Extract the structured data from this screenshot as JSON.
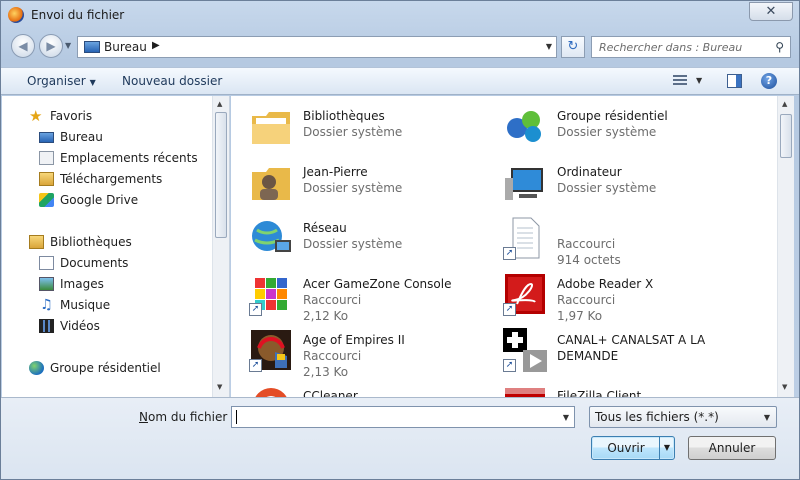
{
  "window": {
    "title": "Envoi du fichier",
    "close_glyph": "✕"
  },
  "address": {
    "location": "Bureau",
    "search_placeholder": "Rechercher dans : Bureau"
  },
  "toolbar": {
    "organize_label": "Organiser",
    "new_folder_label": "Nouveau dossier",
    "help_glyph": "?"
  },
  "sidebar": {
    "favorites": {
      "label": "Favoris"
    },
    "favorite_items": [
      {
        "label": "Bureau",
        "icon": "desktop-icon"
      },
      {
        "label": "Emplacements récents",
        "icon": "recent-places-icon"
      },
      {
        "label": "Téléchargements",
        "icon": "downloads-icon"
      },
      {
        "label": "Google Drive",
        "icon": "google-drive-icon"
      }
    ],
    "libraries": {
      "label": "Bibliothèques"
    },
    "library_items": [
      {
        "label": "Documents",
        "icon": "documents-icon"
      },
      {
        "label": "Images",
        "icon": "pictures-icon"
      },
      {
        "label": "Musique",
        "icon": "music-icon"
      },
      {
        "label": "Vidéos",
        "icon": "videos-icon"
      }
    ],
    "homegroup": {
      "label": "Groupe résidentiel"
    }
  },
  "files": [
    {
      "name": "Bibliothèques",
      "sub1": "Dossier système",
      "sub2": "",
      "icon": "libraries-folder-icon"
    },
    {
      "name": "Groupe résidentiel",
      "sub1": "Dossier système",
      "sub2": "",
      "icon": "homegroup-icon"
    },
    {
      "name": "Jean-Pierre",
      "sub1": "Dossier système",
      "sub2": "",
      "icon": "user-folder-icon"
    },
    {
      "name": "Ordinateur",
      "sub1": "Dossier système",
      "sub2": "",
      "icon": "computer-icon"
    },
    {
      "name": "Réseau",
      "sub1": "Dossier système",
      "sub2": "",
      "icon": "network-icon"
    },
    {
      "name": "",
      "sub1": "Raccourci",
      "sub2": "914 octets",
      "icon": "blank-shortcut-icon"
    },
    {
      "name": "Acer GameZone Console",
      "sub1": "Raccourci",
      "sub2": "2,12 Ko",
      "icon": "gamezone-icon"
    },
    {
      "name": "Adobe Reader X",
      "sub1": "Raccourci",
      "sub2": "1,97 Ko",
      "icon": "adobe-reader-icon"
    },
    {
      "name": "Age of Empires II",
      "sub1": "Raccourci",
      "sub2": "2,13 Ko",
      "icon": "age-of-empires-icon"
    },
    {
      "name": "CANAL+ CANALSAT A LA",
      "sub1": "DEMANDE",
      "sub2": "",
      "icon": "canal-plus-icon"
    },
    {
      "name": "CCleaner",
      "sub1": "",
      "sub2": "",
      "icon": "ccleaner-icon"
    },
    {
      "name": "FileZilla Client",
      "sub1": "",
      "sub2": "",
      "icon": "filezilla-icon"
    }
  ],
  "bottom": {
    "filename_label_underlined": "N",
    "filename_label_rest": "om du fichier :",
    "filename_value": "",
    "filter_value": "Tous les fichiers (*.*)",
    "open_label": "Ouvrir",
    "cancel_label": "Annuler"
  },
  "colors": {
    "accent": "#3c7fb1",
    "window_frame": "#b5c9e1",
    "link_text": "#1e395b"
  }
}
